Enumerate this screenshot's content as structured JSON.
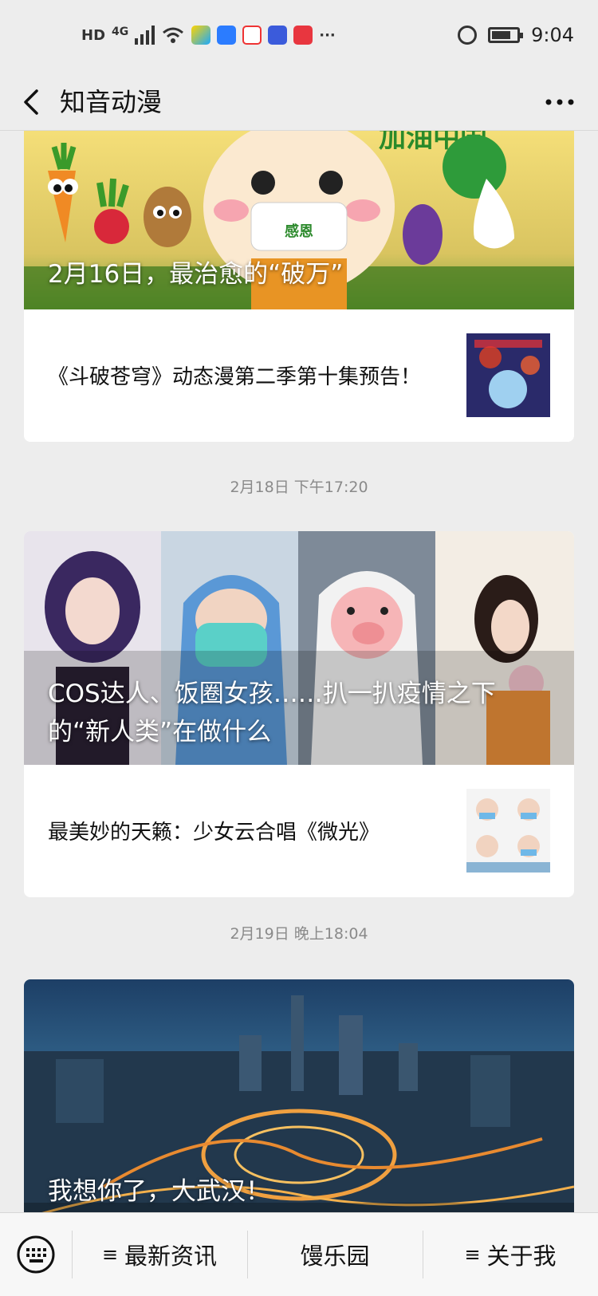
{
  "status_bar": {
    "hd": "HD",
    "network": "4G",
    "more": "···",
    "time": "9:04",
    "icons": [
      "signal-icon",
      "wifi-icon",
      "video-app-icon",
      "browser-app-icon",
      "maps-app-icon",
      "baidu-app-icon",
      "huawei-app-icon",
      "alarm-icon",
      "battery-icon"
    ],
    "battery_level": 0.75
  },
  "header": {
    "title": "知音动漫",
    "back_icon": "chevron-left-icon",
    "more_icon": "ellipsis-icon"
  },
  "feed": {
    "items": [
      {
        "hero_title": "2月16日，最治愈的“破万”",
        "sub_article": "《斗破苍穹》动态漫第二季第十集预告！"
      },
      {
        "timestamp": "2月18日 下午17:20",
        "hero_title": "COS达人、饭圈女孩……扒一扒疫情之下的“新人类”在做什么",
        "sub_article": "最美妙的天籁：少女云合唱《微光》"
      },
      {
        "timestamp": "2月19日 晚上18:04",
        "hero_title": "我想你了，大武汉！"
      }
    ],
    "banner_texts": {
      "top_right": "加油中国",
      "mask_label": "感恩"
    }
  },
  "bottom_menu": {
    "keyboard_icon": "keyboard-icon",
    "items": [
      {
        "label": "最新资讯",
        "prefix": "≡"
      },
      {
        "label": "馒乐园",
        "prefix": ""
      },
      {
        "label": "关于我",
        "prefix": "≡"
      }
    ]
  },
  "colors": {
    "background": "#ededed",
    "card": "#ffffff",
    "timestamp": "#8a8a8a",
    "menu_bg": "#f7f7f7"
  }
}
